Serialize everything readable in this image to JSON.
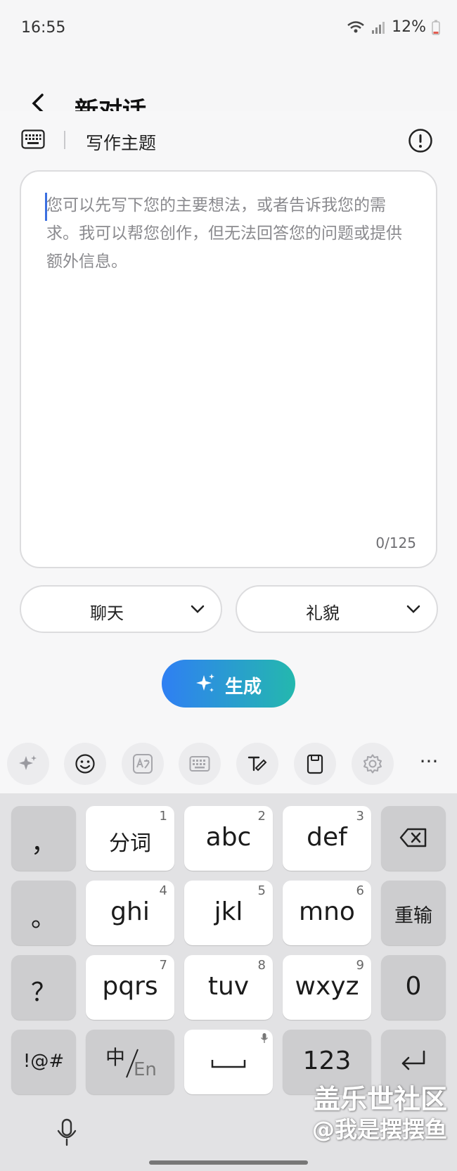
{
  "status_bar": {
    "time": "16:55",
    "battery": "12%"
  },
  "header": {
    "title": "新对话"
  },
  "writing": {
    "topic_label": "写作主题"
  },
  "prompt": {
    "placeholder": "您可以先写下您的主要想法，或者告诉我您的需求。我可以帮您创作，但无法回答您的问题或提供额外信息。",
    "counter": "0/125"
  },
  "selects": {
    "format": "聊天",
    "tone": "礼貌"
  },
  "generate": {
    "label": "生成"
  },
  "keyboard_toolbar": {
    "icons": [
      "sparkle-icon",
      "emoji-icon",
      "translate-icon",
      "keyboard-icon",
      "handwriting-icon",
      "clipboard-icon",
      "settings-icon",
      "more-icon"
    ],
    "more": "···"
  },
  "keyboard": {
    "row1": {
      "punct": "，",
      "k1": "分词",
      "k1_hint": "1",
      "k2": "abc",
      "k2_hint": "2",
      "k3": "def",
      "k3_hint": "3"
    },
    "row2": {
      "punct": "。",
      "k4": "ghi",
      "k4_hint": "4",
      "k5": "jkl",
      "k5_hint": "5",
      "k6": "mno",
      "k6_hint": "6",
      "retype": "重输"
    },
    "row3": {
      "punct": "？",
      "k7": "pqrs",
      "k7_hint": "7",
      "k8": "tuv",
      "k8_hint": "8",
      "k9": "wxyz",
      "k9_hint": "9",
      "zero": "0"
    },
    "row4": {
      "symbols": "!@#",
      "lang_cn": "中",
      "lang_en": "En",
      "num": "123"
    }
  },
  "watermark": {
    "line1": "盖乐世社区",
    "line2": "@我是摆摆鱼"
  },
  "colors": {
    "accent": "#2f7ff3",
    "accent_end": "#24b8ae",
    "caret": "#3b6fe0"
  }
}
